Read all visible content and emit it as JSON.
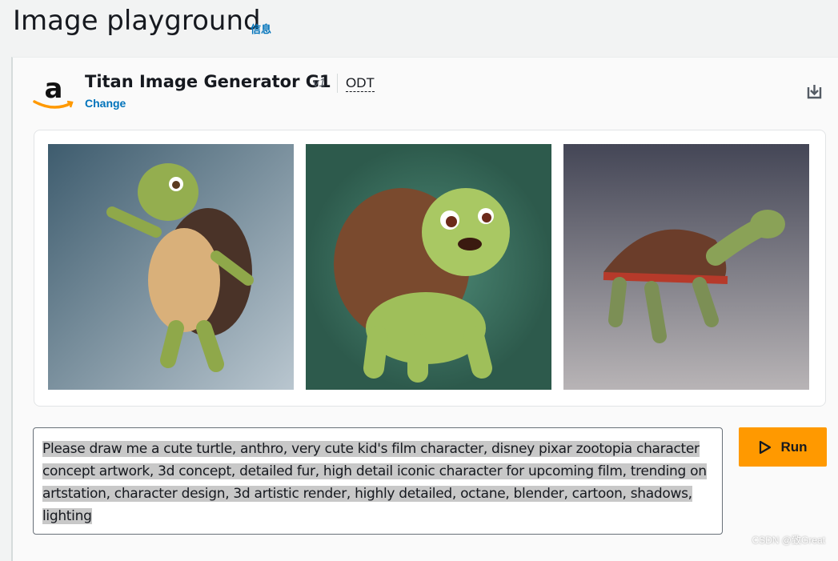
{
  "header": {
    "title": "Image playground",
    "info_link": "信息"
  },
  "model": {
    "name": "Titan Image Generator G1",
    "version": "v1",
    "mode": "ODT",
    "change_label": "Change"
  },
  "images": [
    {
      "alt": "cute turtle standing waving"
    },
    {
      "alt": "cute turtle with big shell"
    },
    {
      "alt": "turtle walking"
    }
  ],
  "prompt": {
    "value": "Please draw me a cute turtle, anthro, very cute kid's film character, disney pixar zootopia character concept artwork, 3d concept, detailed fur, high detail iconic character for upcoming film, trending on artstation, character design, 3d artistic render, highly detailed, octane, blender, cartoon, shadows, lighting"
  },
  "run": {
    "label": "Run"
  },
  "watermark": "CSDN @致Great",
  "colors": {
    "accent": "#ff9900",
    "link": "#0073bb"
  }
}
